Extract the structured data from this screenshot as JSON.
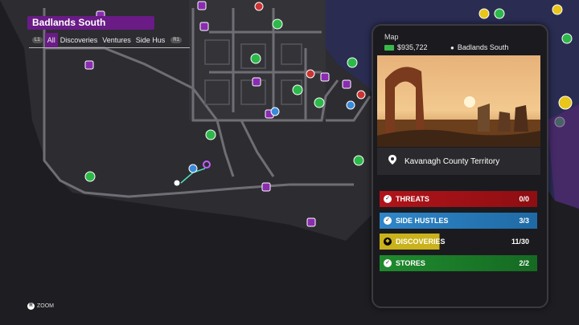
{
  "region": {
    "title": "Badlands South"
  },
  "filters": {
    "left_button": "L1",
    "right_button": "R1",
    "tabs": [
      "All",
      "Discoveries",
      "Ventures",
      "Side Hus"
    ],
    "active_index": 0
  },
  "zoom": {
    "button": "R",
    "label": "ZOOM"
  },
  "phone": {
    "header": "Map",
    "money": "$935,722",
    "location": "Badlands South",
    "territory": "Kavanagh County Territory",
    "categories": [
      {
        "label": "THREATS",
        "count": "0/0",
        "color": "#b0141a"
      },
      {
        "label": "SIDE HUSTLES",
        "count": "3/3",
        "color": "#2f86c8"
      },
      {
        "label": "DISCOVERIES",
        "count": "11/30",
        "color": "#c9b21c"
      },
      {
        "label": "STORES",
        "count": "2/2",
        "color": "#1f8a2e"
      }
    ]
  },
  "colors": {
    "accent": "#6a1b86",
    "water": "#2a2c52",
    "land": "#2a2a2e",
    "road": "#6e6e74"
  }
}
